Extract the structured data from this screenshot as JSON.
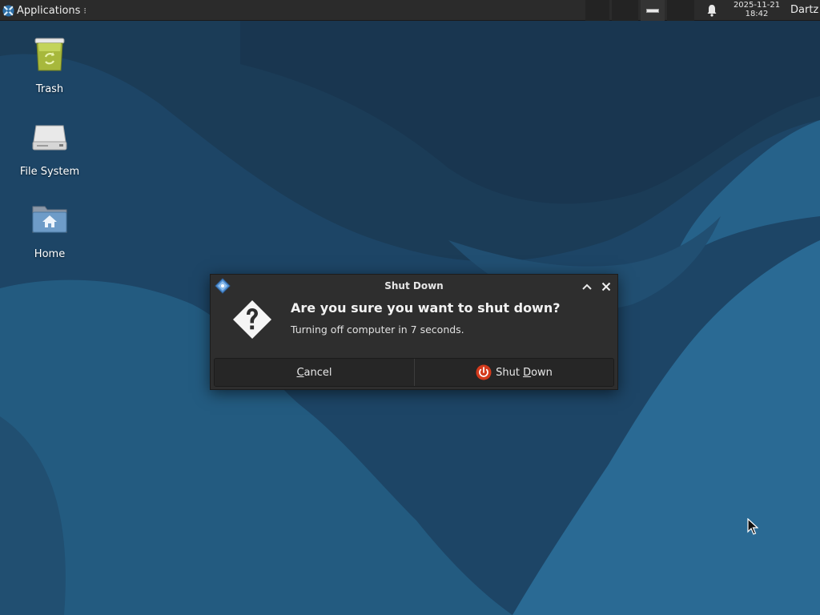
{
  "panel": {
    "apps_label": "Applications",
    "apps_grip": "⁝",
    "clock_date": "2025-11-21",
    "clock_time": "18:42",
    "user": "Dartz"
  },
  "desktop_icons": [
    {
      "label": "Trash",
      "icon": "trash-icon"
    },
    {
      "label": "File System",
      "icon": "drive-icon"
    },
    {
      "label": "Home",
      "icon": "home-folder-icon"
    }
  ],
  "dialog": {
    "title": "Shut Down",
    "heading": "Are you sure you want to shut down?",
    "message": "Turning off computer in 7 seconds.",
    "cancel_label": {
      "mnemonic": "C",
      "rest": "ancel"
    },
    "confirm_label": {
      "before": "Shut ",
      "mnemonic": "D",
      "rest": "own"
    }
  },
  "colors": {
    "panel": "#2b2b2b",
    "dialog_bg": "#2e2e2e",
    "wallpaper_dark": "#1b3f5c",
    "wallpaper_light": "#2a6790",
    "power_red": "#d33a1c"
  }
}
